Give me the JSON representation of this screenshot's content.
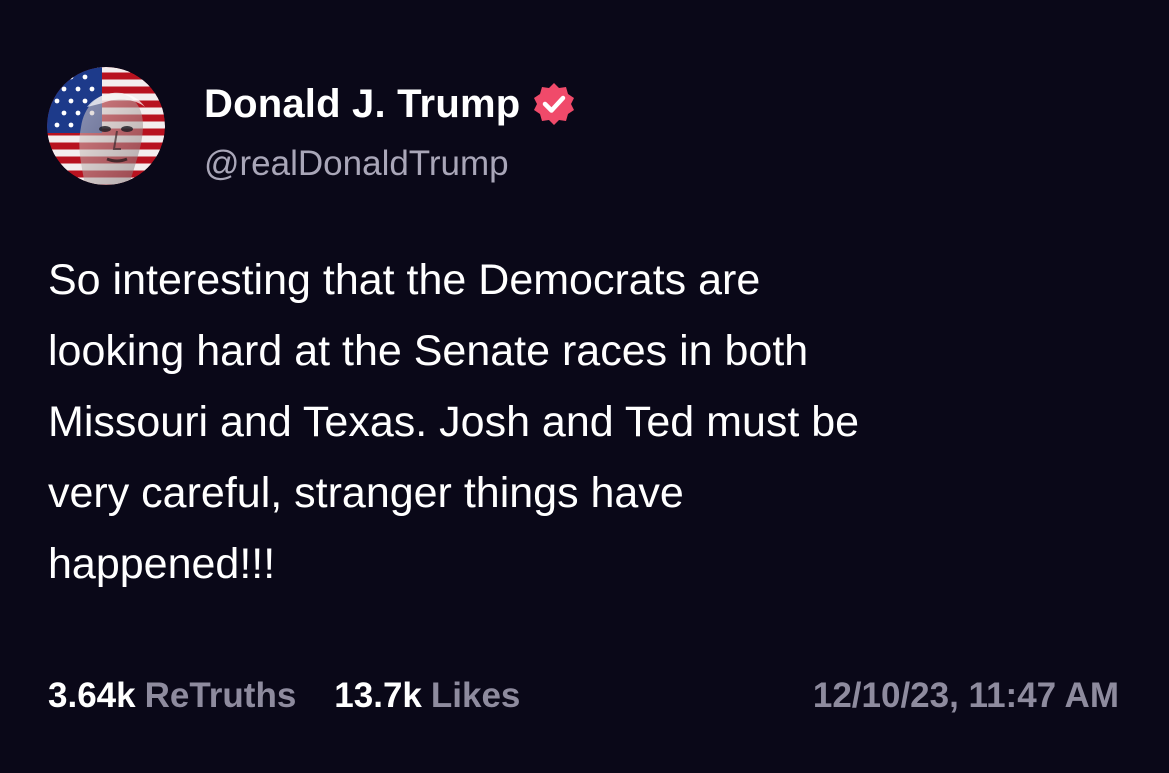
{
  "post": {
    "author": {
      "display_name": "Donald J. Trump",
      "handle": "@realDonaldTrump",
      "verified": true,
      "avatar_icon": "avatar-portrait-flag-icon",
      "verified_icon": "verified-badge-icon"
    },
    "text_lines": [
      "So interesting that the Democrats are",
      "looking hard at the Senate races in both",
      "Missouri and Texas. Josh and Ted must be",
      "very careful, stranger things have",
      "happened!!!"
    ],
    "stats": {
      "retruths_count": "3.64k",
      "retruths_label": "ReTruths",
      "likes_count": "13.7k",
      "likes_label": "Likes"
    },
    "timestamp": "12/10/23, 11:47 AM"
  },
  "colors": {
    "background": "#0a0818",
    "text_primary": "#ffffff",
    "text_secondary": "#8e8b9e",
    "verified_badge": "#f04a6a"
  }
}
